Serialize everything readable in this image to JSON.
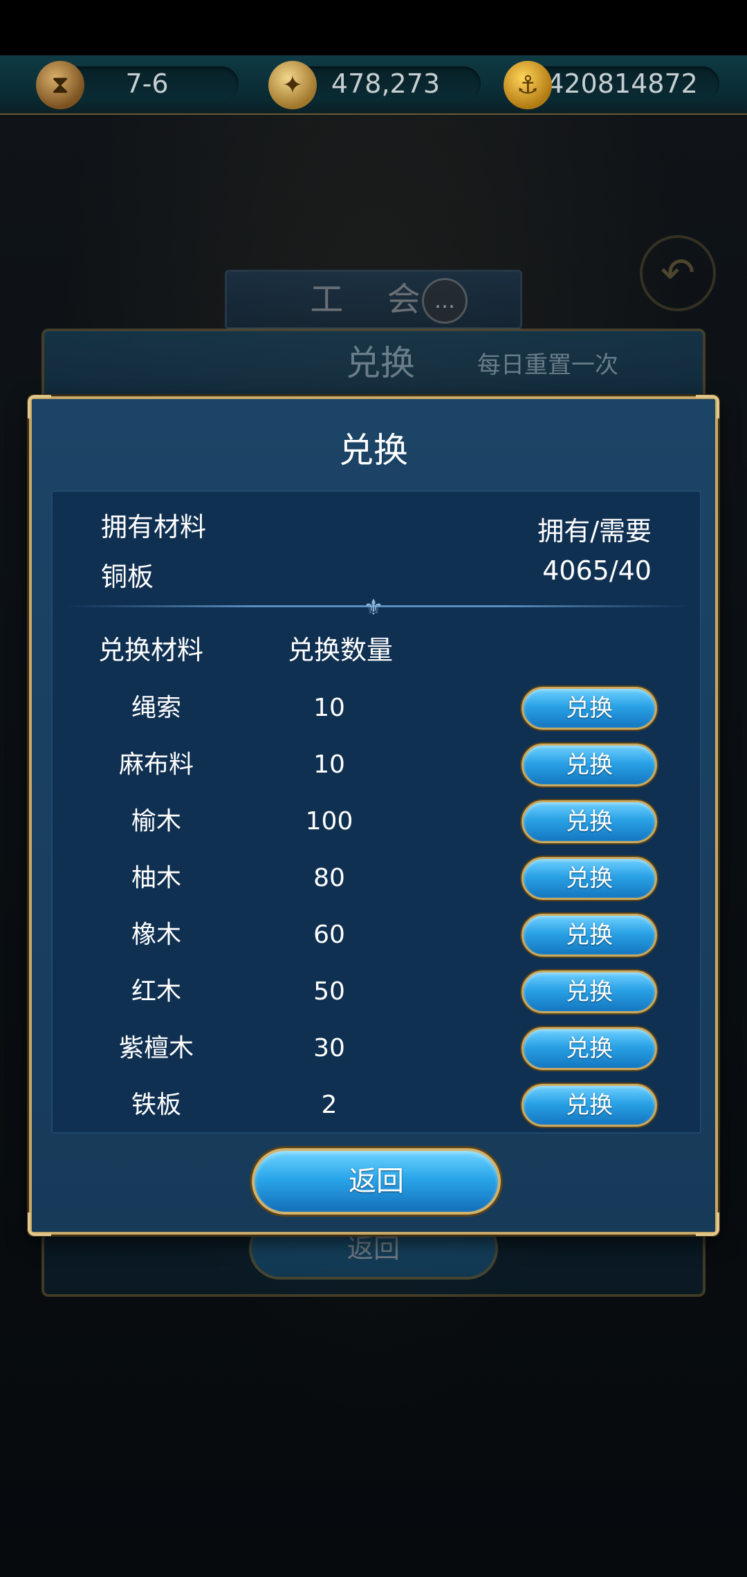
{
  "resource_bar": {
    "stage": "7-6",
    "compass_value": "478,273",
    "gold_value": "420814872",
    "icons": [
      "hourglass-icon",
      "compass-icon",
      "anchor-coin-icon"
    ]
  },
  "background": {
    "guild_tab_label": "工 会",
    "under_title": "兑换",
    "under_subtitle": "每日重置一次",
    "under_back_label": "返回"
  },
  "dialog": {
    "title": "兑换",
    "owned_material_header": "拥有材料",
    "owned_need_header": "拥有/需要",
    "owned_material": "铜板",
    "owned_need_value": "4065/40",
    "exchange_material_header": "兑换材料",
    "exchange_qty_header": "兑换数量",
    "rows": [
      {
        "name": "绳索",
        "qty": "10",
        "button": "兑换"
      },
      {
        "name": "麻布料",
        "qty": "10",
        "button": "兑换"
      },
      {
        "name": "榆木",
        "qty": "100",
        "button": "兑换"
      },
      {
        "name": "柚木",
        "qty": "80",
        "button": "兑换"
      },
      {
        "name": "橡木",
        "qty": "60",
        "button": "兑换"
      },
      {
        "name": "红木",
        "qty": "50",
        "button": "兑换"
      },
      {
        "name": "紫檀木",
        "qty": "30",
        "button": "兑换"
      },
      {
        "name": "铁板",
        "qty": "2",
        "button": "兑换"
      }
    ],
    "back_label": "返回"
  },
  "colors": {
    "accent_gold": "#c8aa6a",
    "button_blue": "#2aa2e6",
    "panel_blue": "#173a59"
  }
}
